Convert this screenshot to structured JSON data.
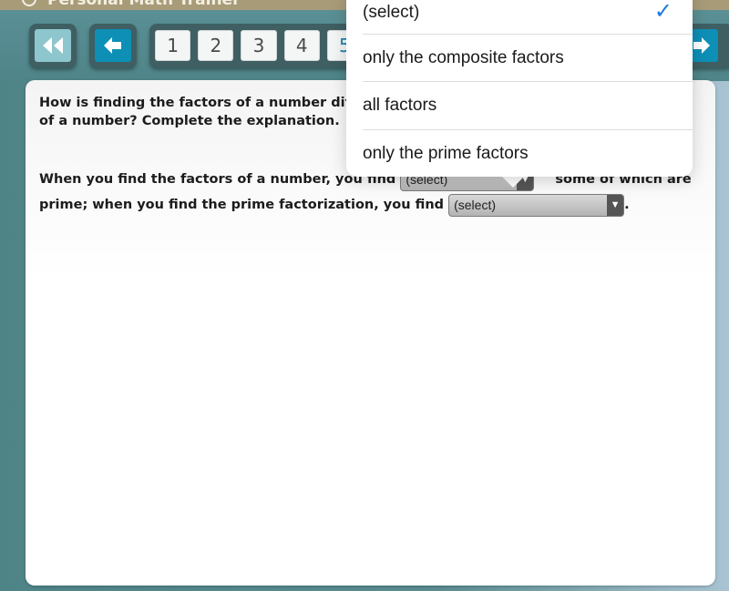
{
  "app": {
    "title": "Personal Math Trainer"
  },
  "navigation": {
    "first_icon": "double-chevron-left-icon",
    "prev_icon": "arrow-left-icon",
    "next_icon": "arrow-right-icon",
    "pages": [
      "1",
      "2",
      "3",
      "4",
      "5"
    ],
    "current_page": "5"
  },
  "question": {
    "line1_visible": "How is finding the factors of a number diff",
    "line2": "of a number? Complete the explanation."
  },
  "answer": {
    "part1": "When you find the factors of a number, you find",
    "part2_visible": "some of which are",
    "part3": "prime; when you find the prime factorization, you find",
    "part4": ".",
    "select1_value": "(select)",
    "select2_value": "(select)",
    "select_arrow": "▼"
  },
  "dropdown": {
    "options": [
      {
        "label": "(select)",
        "selected": true
      },
      {
        "label": "only the composite factors",
        "selected": false
      },
      {
        "label": "all factors",
        "selected": false
      },
      {
        "label": "only the prime factors",
        "selected": false
      }
    ],
    "check_glyph": "✓",
    "accent_color": "#1a7ae0"
  }
}
